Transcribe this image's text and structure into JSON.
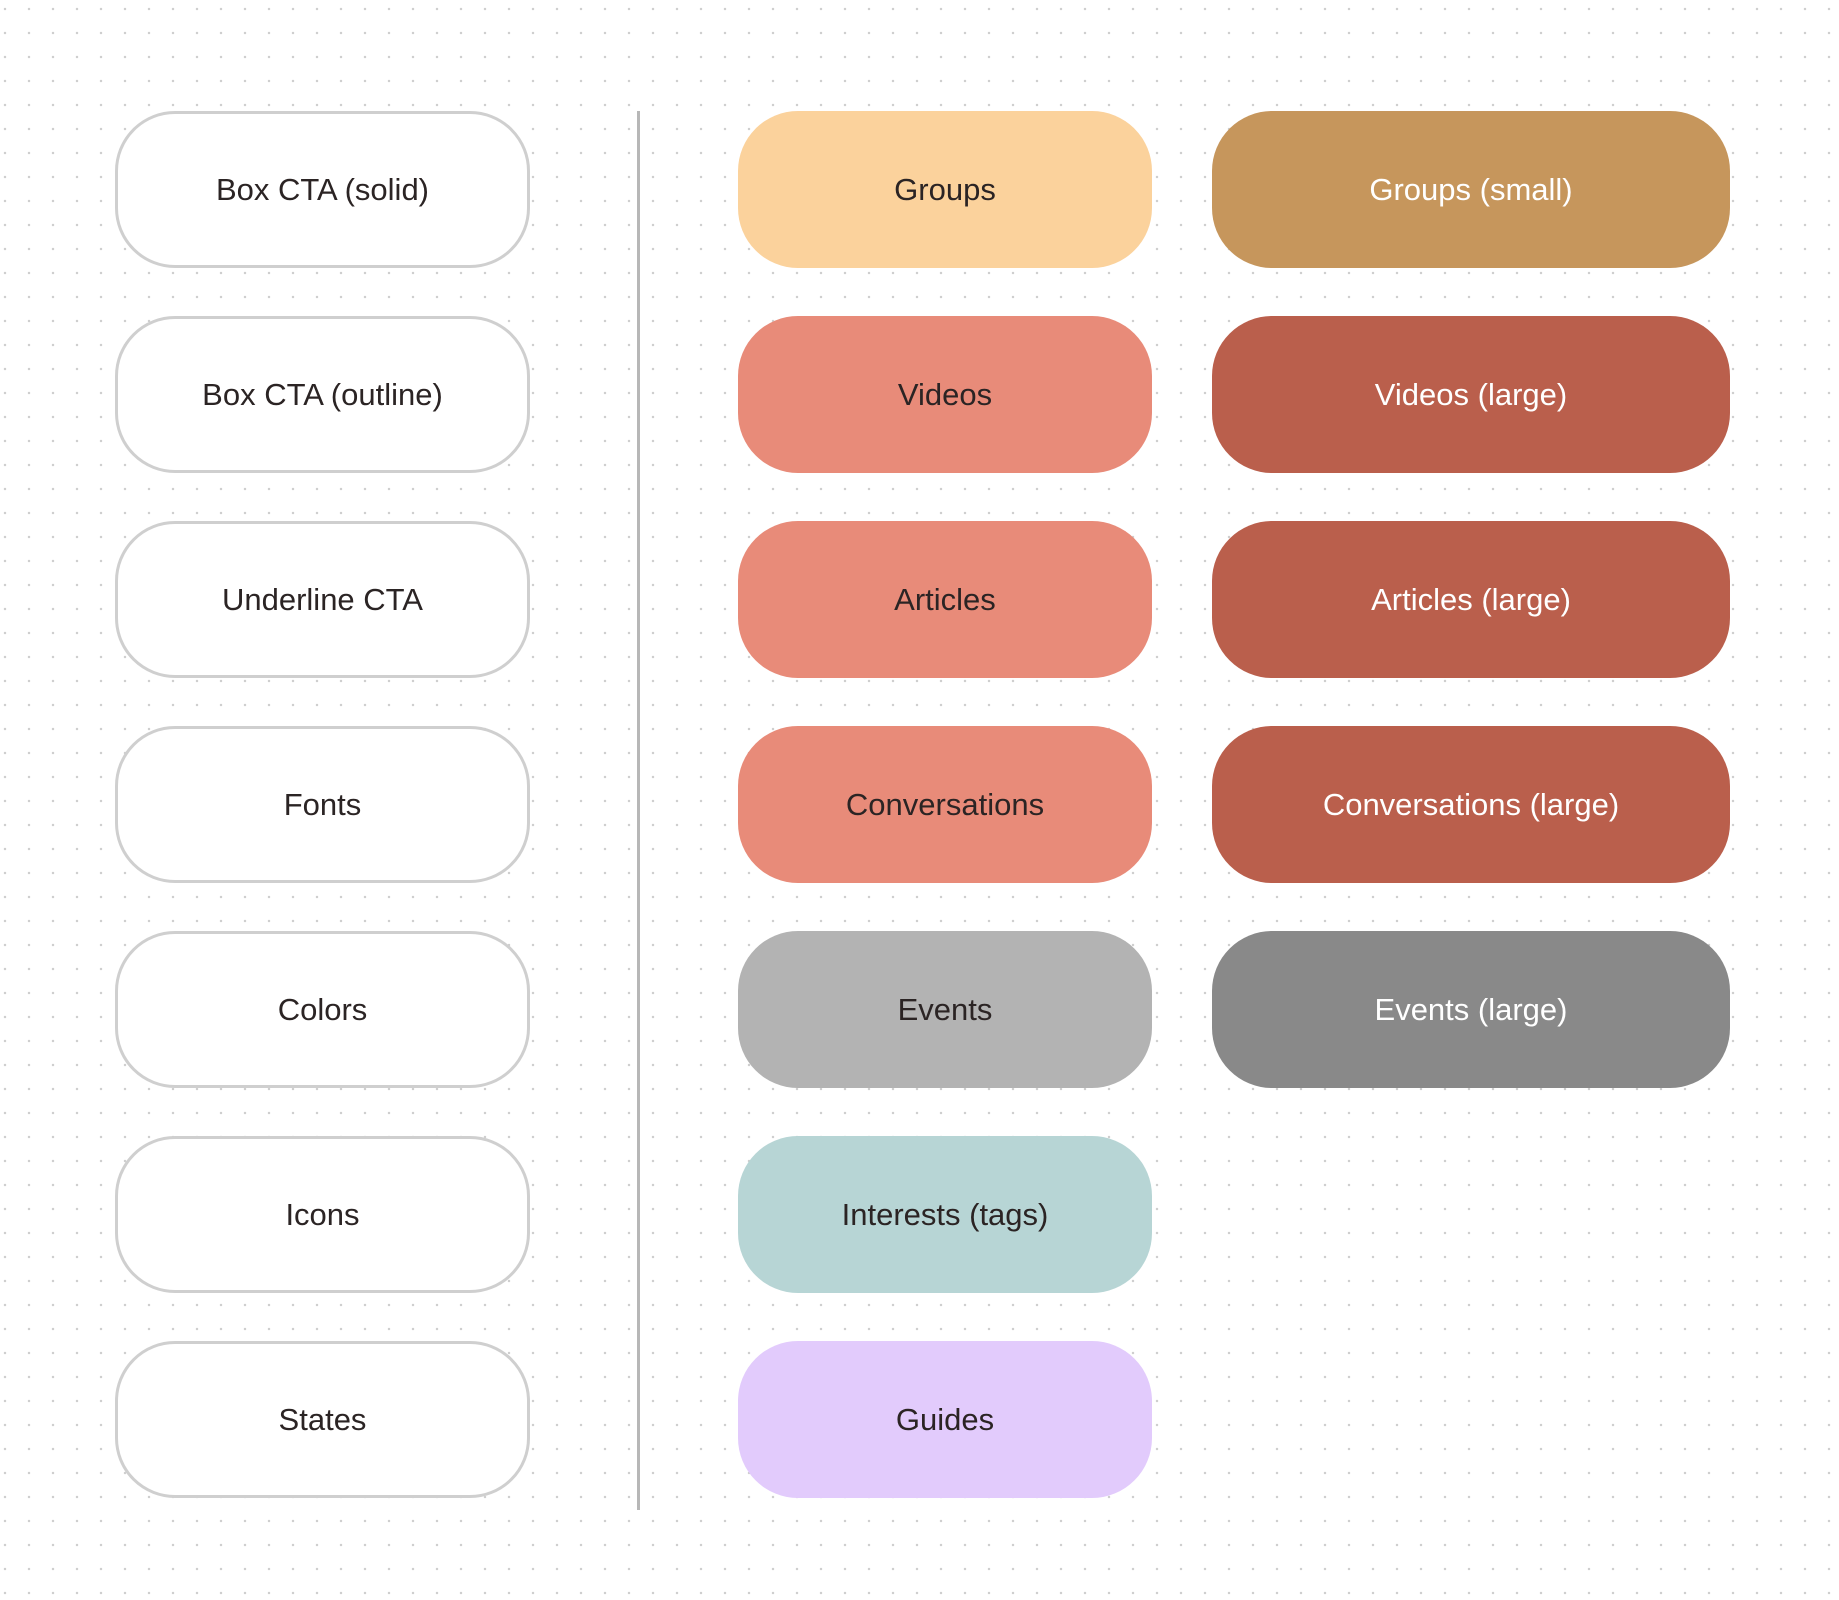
{
  "left_column": [
    {
      "label": "Box CTA (solid)"
    },
    {
      "label": "Box CTA (outline)"
    },
    {
      "label": "Underline CTA"
    },
    {
      "label": "Fonts"
    },
    {
      "label": "Colors"
    },
    {
      "label": "Icons"
    },
    {
      "label": "States"
    }
  ],
  "middle_column": [
    {
      "label": "Groups",
      "color": "#fbd29c"
    },
    {
      "label": "Videos",
      "color": "#e88b79"
    },
    {
      "label": "Articles",
      "color": "#e88b79"
    },
    {
      "label": "Conversations",
      "color": "#e88b79"
    },
    {
      "label": "Events",
      "color": "#b3b3b3"
    },
    {
      "label": "Interests (tags)",
      "color": "#b7d5d5"
    },
    {
      "label": "Guides",
      "color": "#e2cbfc"
    }
  ],
  "right_column": [
    {
      "label": "Groups (small)",
      "color": "#c6965c"
    },
    {
      "label": "Videos (large)",
      "color": "#ba5f4c"
    },
    {
      "label": "Articles (large)",
      "color": "#ba5f4c"
    },
    {
      "label": "Conversations (large)",
      "color": "#ba5f4c"
    },
    {
      "label": "Events (large)",
      "color": "#898989"
    }
  ]
}
